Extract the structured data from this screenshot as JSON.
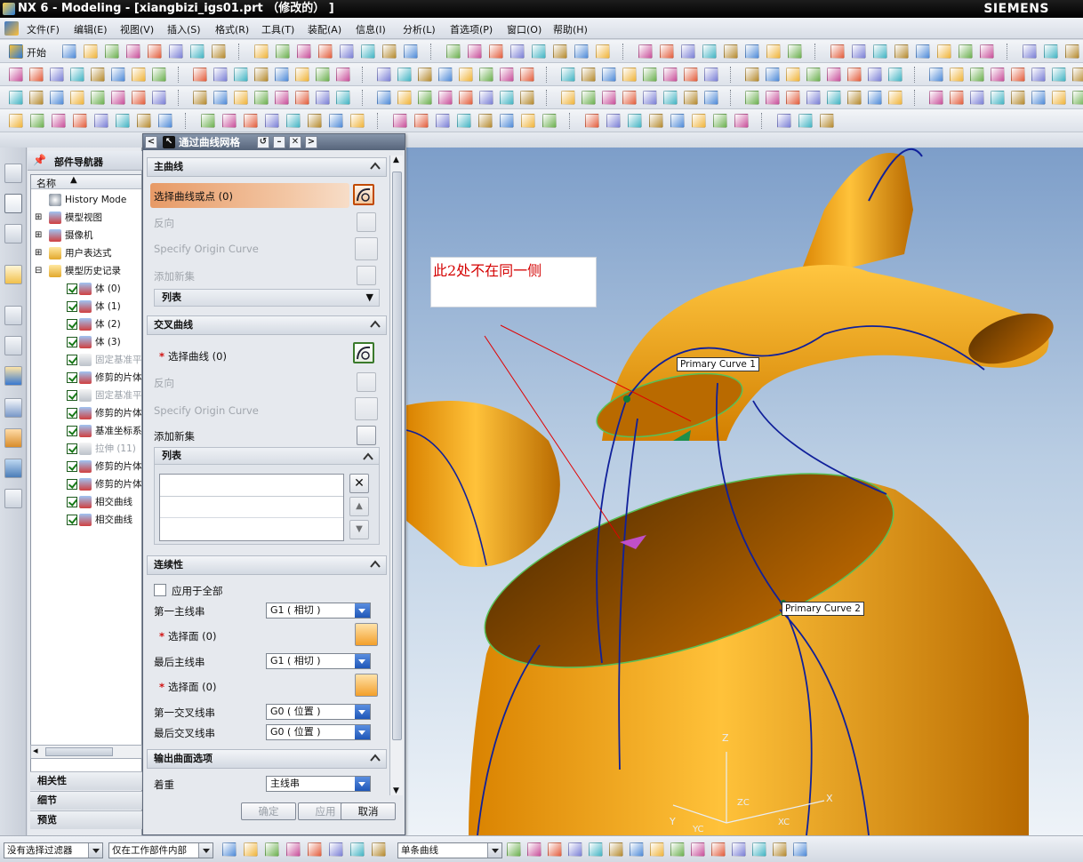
{
  "window": {
    "title": "NX 6 - Modeling - [xiangbizi_igs01.prt （修改的） ]",
    "brand": "SIEMENS"
  },
  "menu": [
    "文件(F)",
    "编辑(E)",
    "视图(V)",
    "插入(S)",
    "格式(R)",
    "工具(T)",
    "装配(A)",
    "信息(I)",
    "分析(L)",
    "首选项(P)",
    "窗口(O)",
    "帮助(H)"
  ],
  "toolbar": {
    "start_label": "开始"
  },
  "navigator": {
    "title": "部件导航器",
    "column": "名称",
    "items": [
      {
        "label": "History Mode",
        "dim": false
      },
      {
        "label": "模型视图",
        "dim": false
      },
      {
        "label": "摄像机",
        "dim": false
      },
      {
        "label": "用户表达式",
        "dim": false
      },
      {
        "label": "模型历史记录",
        "dim": false
      },
      {
        "label": "体 (0)",
        "dim": false
      },
      {
        "label": "体 (1)",
        "dim": false
      },
      {
        "label": "体 (2)",
        "dim": false
      },
      {
        "label": "体 (3)",
        "dim": false
      },
      {
        "label": "固定基准平",
        "dim": true
      },
      {
        "label": "修剪的片体",
        "dim": false
      },
      {
        "label": "固定基准平",
        "dim": true
      },
      {
        "label": "修剪的片体",
        "dim": false
      },
      {
        "label": "基准坐标系",
        "dim": false
      },
      {
        "label": "拉伸 (11)",
        "dim": true
      },
      {
        "label": "修剪的片体",
        "dim": false
      },
      {
        "label": "修剪的片体",
        "dim": false
      },
      {
        "label": "相交曲线",
        "dim": false
      },
      {
        "label": "相交曲线",
        "dim": false
      }
    ],
    "bottom_sections": [
      "相关性",
      "细节",
      "预览"
    ]
  },
  "dialog": {
    "title": "通过曲线网格",
    "primary_curves": {
      "header": "主曲线",
      "select": "选择曲线或点 (0)",
      "reverse": "反向",
      "specify_origin": "Specify Origin Curve",
      "add_new_set": "添加新集",
      "list": "列表"
    },
    "cross_curves": {
      "header": "交叉曲线",
      "select": "选择曲线 (0)",
      "reverse": "反向",
      "specify_origin": "Specify Origin Curve",
      "add_new_set": "添加新集",
      "list": "列表"
    },
    "continuity": {
      "header": "连续性",
      "apply_all": "应用于全部",
      "first_primary": "第一主线串",
      "first_primary_value": "G1 ( 相切 )",
      "select_face_1": "选择面 (0)",
      "last_primary": "最后主线串",
      "last_primary_value": "G1 ( 相切 )",
      "select_face_2": "选择面 (0)",
      "first_cross": "第一交叉线串",
      "first_cross_value": "G0 ( 位置 )",
      "last_cross": "最后交叉线串",
      "last_cross_value": "G0 ( 位置 )"
    },
    "output": {
      "header": "输出曲面选项",
      "emphasis": "着重",
      "emphasis_value": "主线串"
    },
    "buttons": {
      "ok": "确定",
      "apply": "应用",
      "cancel": "取消"
    }
  },
  "viewport": {
    "note": "此2处不在同一侧",
    "label_curve1": "Primary Curve  1",
    "label_curve2": "Primary Curve  2",
    "axis_z": "Z",
    "axis_zc": "ZC",
    "axis_x": "X",
    "axis_xc": "XC",
    "axis_y": "Y",
    "axis_yc": "YC",
    "surface_color": "#f0a010",
    "curve_color": "#10209a",
    "highlight_color": "#58c058"
  },
  "statusbar": {
    "filter": "没有选择过滤器",
    "scope": "仅在工作部件内部",
    "curve_rule": "单条曲线"
  }
}
